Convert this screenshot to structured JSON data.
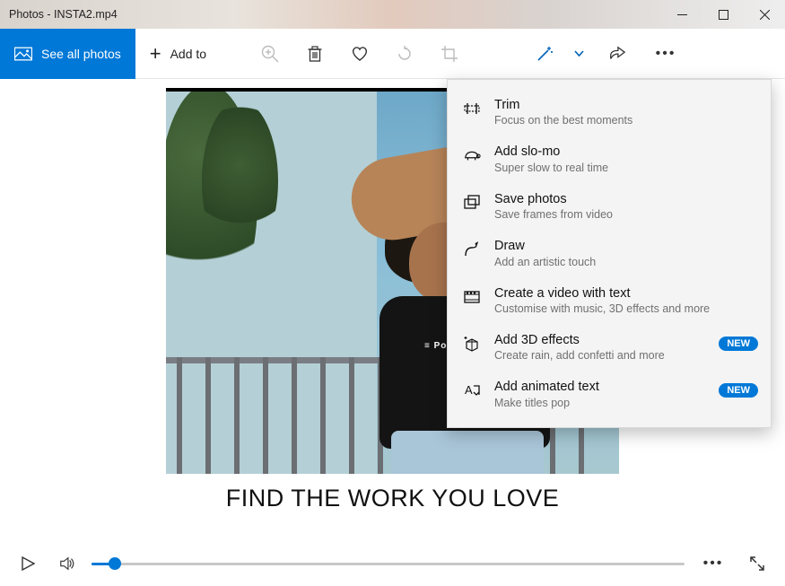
{
  "window": {
    "title": "Photos - INSTA2.mp4"
  },
  "toolbar": {
    "see_all": "See all photos",
    "add_to": "Add to"
  },
  "video": {
    "caption": "FIND THE WORK YOU LOVE",
    "shirt_text": "≡ Polaroid"
  },
  "menu": {
    "badge_new": "NEW",
    "items": [
      {
        "title": "Trim",
        "subtitle": "Focus on the best moments"
      },
      {
        "title": "Add slo-mo",
        "subtitle": "Super slow to real time"
      },
      {
        "title": "Save photos",
        "subtitle": "Save frames from video"
      },
      {
        "title": "Draw",
        "subtitle": "Add an artistic touch"
      },
      {
        "title": "Create a video with text",
        "subtitle": "Customise with music, 3D effects and more"
      },
      {
        "title": "Add 3D effects",
        "subtitle": "Create rain, add confetti and more"
      },
      {
        "title": "Add animated text",
        "subtitle": "Make titles pop"
      }
    ]
  },
  "playbar": {
    "progress_pct": 4
  },
  "colors": {
    "accent": "#0078d7"
  }
}
